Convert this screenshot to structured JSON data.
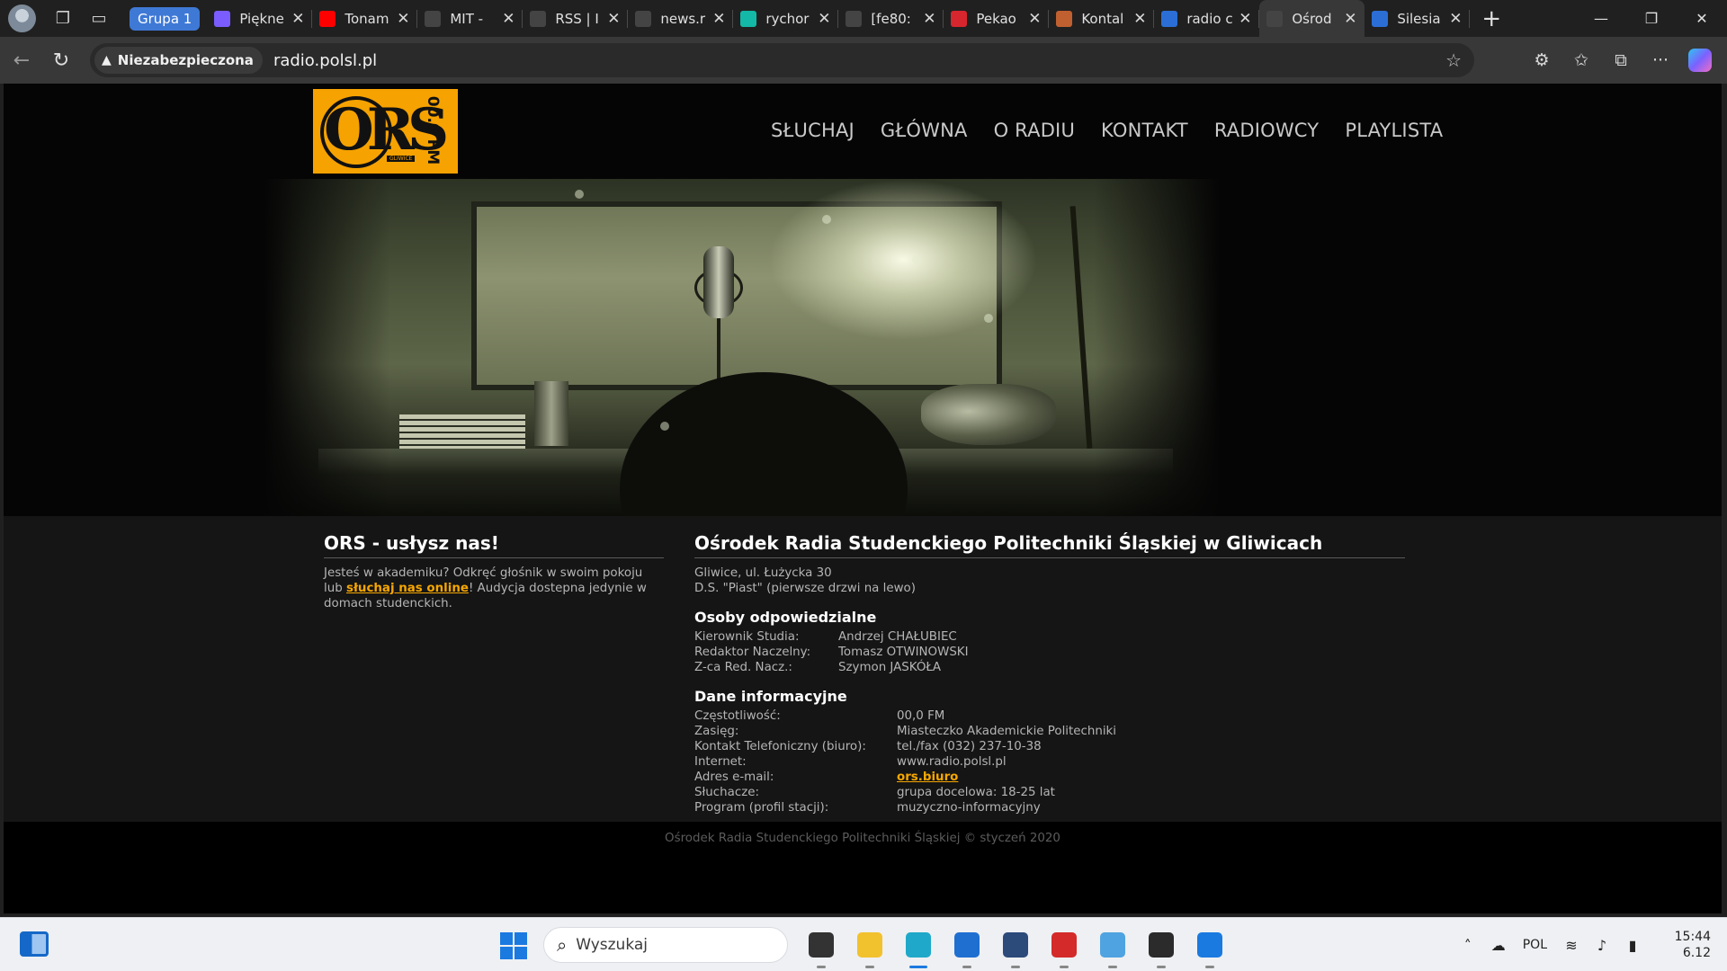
{
  "browser": {
    "tab_group_label": "Grupa 1",
    "tabs": [
      {
        "title": "Piękne",
        "favicon": "butterfly-icon",
        "color": "#7b5cff"
      },
      {
        "title": "Tonam",
        "favicon": "youtube-icon",
        "color": "#ff0000"
      },
      {
        "title": "MIT -",
        "favicon": "bars-icon",
        "color": "#444444"
      },
      {
        "title": "RSS | I",
        "favicon": "bars-icon",
        "color": "#444444"
      },
      {
        "title": "news.r",
        "favicon": "globe-icon",
        "color": "#444444"
      },
      {
        "title": "rychor",
        "favicon": "diamond-icon",
        "color": "#14b8a6"
      },
      {
        "title": "[fe80:",
        "favicon": "document-icon",
        "color": "#444444"
      },
      {
        "title": "Pekao",
        "favicon": "pekao-icon",
        "color": "#d7262e"
      },
      {
        "title": "Kontal",
        "favicon": "pen-icon",
        "color": "#c06030"
      },
      {
        "title": "radio c",
        "favicon": "search-icon",
        "color": "#2b6fd6"
      },
      {
        "title": "Ośrod",
        "favicon": "globe-icon",
        "color": "#444444",
        "active": true
      },
      {
        "title": "Silesia",
        "favicon": "dot-icon",
        "color": "#2b6fd6"
      }
    ],
    "security_label": "Niezabezpieczona",
    "url": "radio.polsl.pl"
  },
  "site": {
    "logo_text": "ORS",
    "logo_fm": "00.0 FM",
    "logo_city": "GLIWICE",
    "nav": [
      "SŁUCHAJ",
      "GŁÓWNA",
      "O RADIU",
      "KONTAKT",
      "RADIOWCY",
      "PLAYLISTA"
    ],
    "left": {
      "title": "ORS - usłysz nas!",
      "text_before": "Jesteś w akademiku? Odkręć głośnik w swoim pokoju lub ",
      "link": "słuchaj nas online",
      "text_after": "! Audycja dostepna jedynie w domach studenckich."
    },
    "right": {
      "title": "Ośrodek Radia Studenckiego Politechniki Śląskiej w Gliwicach",
      "address_line1": "Gliwice, ul. Łużycka 30",
      "address_line2": "D.S. \"Piast\" (pierwsze drzwi na lewo)",
      "people_title": "Osoby odpowiedzialne",
      "people": [
        {
          "role": "Kierownik Studia:",
          "name": "Andrzej CHAŁUBIEC"
        },
        {
          "role": "Redaktor Naczelny:",
          "name": "Tomasz OTWINOWSKI"
        },
        {
          "role": "Z-ca Red. Nacz.:",
          "name": "Szymon JASKÓŁA"
        }
      ],
      "info_title": "Dane informacyjne",
      "info": [
        {
          "key": "Częstotliwość:",
          "value": "00,0 FM"
        },
        {
          "key": "Zasięg:",
          "value": "Miasteczko Akademickie Politechniki"
        },
        {
          "key": "Kontakt Telefoniczny (biuro):",
          "value": "tel./fax (032) 237-10-38"
        },
        {
          "key": "Internet:",
          "value": "www.radio.polsl.pl"
        },
        {
          "key": "Adres e-mail:",
          "value": "ors.biuro",
          "link": true
        },
        {
          "key": "Słuchacze:",
          "value": "grupa docelowa: 18-25 lat"
        },
        {
          "key": "Program (profil stacji):",
          "value": "muzyczno-informacyjny"
        }
      ]
    },
    "footer": "Ośrodek Radia Studenckiego Politechniki Śląskiej © styczeń 2020"
  },
  "taskbar": {
    "search_placeholder": "Wyszukaj",
    "apps": [
      {
        "name": "task-view-icon",
        "color": "#333333"
      },
      {
        "name": "file-explorer-icon",
        "color": "#f2c12e"
      },
      {
        "name": "edge-icon",
        "color": "#1fa8c9",
        "active": true
      },
      {
        "name": "store-icon",
        "color": "#1f6fd1"
      },
      {
        "name": "3d-box-icon",
        "color": "#2c4a7a"
      },
      {
        "name": "pdf-reader-icon",
        "color": "#d42a2a"
      },
      {
        "name": "monitor-app-icon",
        "color": "#4fa3e0"
      },
      {
        "name": "terminal-icon",
        "color": "#2b2b2b"
      },
      {
        "name": "audio-app-icon",
        "color": "#1b7ae0"
      }
    ],
    "language": "POL",
    "time": "15:44",
    "date": "6.12"
  }
}
